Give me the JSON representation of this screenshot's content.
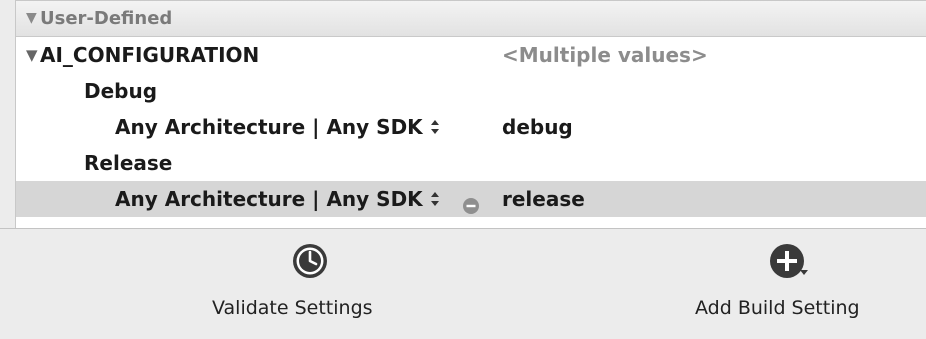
{
  "group": {
    "title": "User-Defined"
  },
  "settings": {
    "name": "AI_CONFIGURATION",
    "value": "<Multiple values>",
    "configs": [
      {
        "name": "Debug",
        "condition": "Any Architecture | Any SDK",
        "value": "debug"
      },
      {
        "name": "Release",
        "condition": "Any Architecture | Any SDK",
        "value": "release"
      }
    ]
  },
  "toolbar": {
    "validate_label": "Validate Settings",
    "add_label": "Add Build Setting"
  },
  "icons": {
    "validate": "clock-icon",
    "add": "plus-circle-icon",
    "remove": "minus-circle-icon",
    "disclosure": "disclosure-triangle-icon",
    "stepper": "up-down-stepper-icon"
  }
}
